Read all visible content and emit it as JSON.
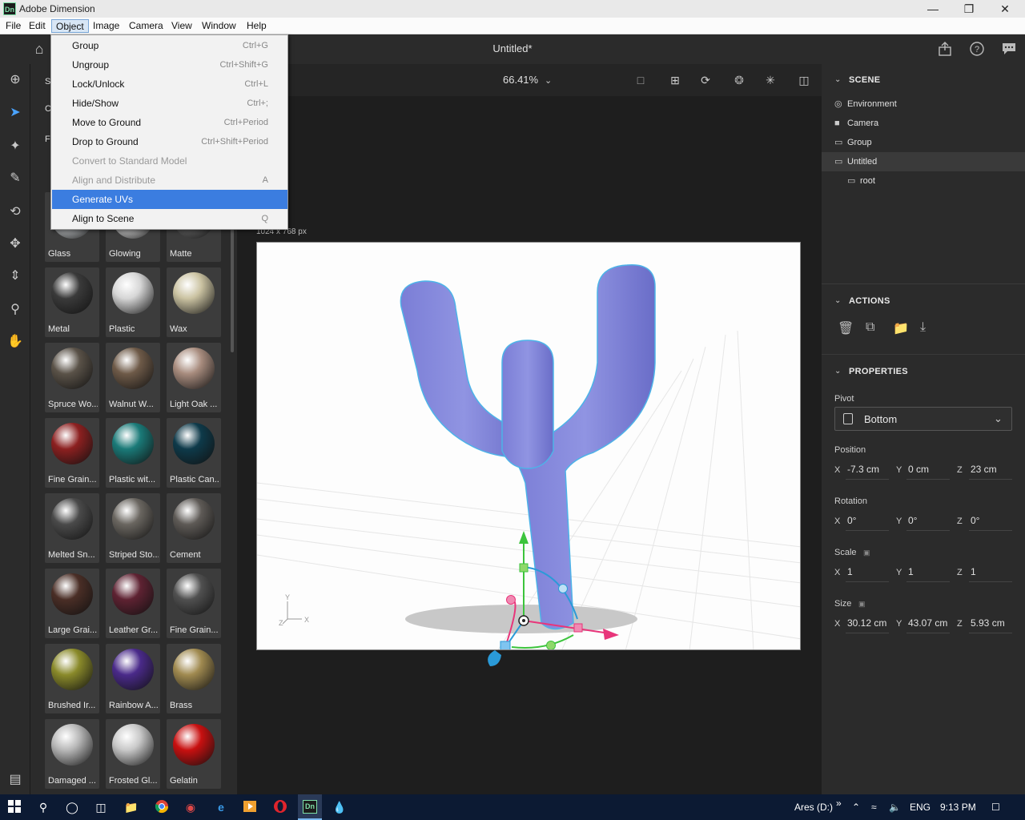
{
  "window": {
    "title": "Adobe Dimension",
    "logo": "Dn",
    "minimize_icon": "minimize-icon",
    "maximize_icon": "restore-icon",
    "close_icon": "close-icon"
  },
  "menubar": [
    "File",
    "Edit",
    "Object",
    "Image",
    "Camera",
    "View",
    "Window",
    "Help"
  ],
  "header": {
    "doc_title": "Untitled*"
  },
  "object_menu": [
    {
      "label": "Group",
      "shortcut": "Ctrl+G",
      "state": "normal"
    },
    {
      "label": "Ungroup",
      "shortcut": "Ctrl+Shift+G",
      "state": "normal"
    },
    {
      "label": "Lock/Unlock",
      "shortcut": "Ctrl+L",
      "state": "normal"
    },
    {
      "label": "Hide/Show",
      "shortcut": "Ctrl+;",
      "state": "normal"
    },
    {
      "label": "Move to Ground",
      "shortcut": "Ctrl+Period",
      "state": "normal"
    },
    {
      "label": "Drop to Ground",
      "shortcut": "Ctrl+Shift+Period",
      "state": "normal"
    },
    {
      "label": "Convert to Standard Model",
      "shortcut": "",
      "state": "disabled"
    },
    {
      "label": "Align and Distribute",
      "shortcut": "A",
      "state": "disabled"
    },
    {
      "label": "Generate UVs",
      "shortcut": "",
      "state": "highlighted"
    },
    {
      "label": "Align to Scene",
      "shortcut": "Q",
      "state": "normal"
    }
  ],
  "canvas": {
    "zoom": "66.41%",
    "size_label": "1024 x 768 px",
    "axis_labels": {
      "y": "Y",
      "x": "X",
      "z": "Z"
    }
  },
  "materials": [
    {
      "label": "Glass",
      "color": "#cfd3d6"
    },
    {
      "label": "Glowing",
      "color": "#e8e8e8"
    },
    {
      "label": "Matte",
      "color": "#6d6d6d"
    },
    {
      "label": "Metal",
      "color": "#3a3a3a"
    },
    {
      "label": "Plastic",
      "color": "#d6d6d6"
    },
    {
      "label": "Wax",
      "color": "#cbc3a2"
    },
    {
      "label": "Spruce Wo...",
      "color": "#5a5248"
    },
    {
      "label": "Walnut W...",
      "color": "#6e5a48"
    },
    {
      "label": "Light Oak ...",
      "color": "#a88c7e"
    },
    {
      "label": "Fine Grain...",
      "color": "#8c2020"
    },
    {
      "label": "Plastic wit...",
      "color": "#1a7a78"
    },
    {
      "label": "Plastic Can...",
      "color": "#0e3a4a"
    },
    {
      "label": "Melted Sn...",
      "color": "#4a4a4a"
    },
    {
      "label": "Striped Sto...",
      "color": "#6a6660"
    },
    {
      "label": "Cement",
      "color": "#5e5a56"
    },
    {
      "label": "Large Grai...",
      "color": "#4a2e26"
    },
    {
      "label": "Leather Gr...",
      "color": "#5e2232"
    },
    {
      "label": "Fine Grain...",
      "color": "#505050"
    },
    {
      "label": "Brushed Ir...",
      "color": "#8a8a2a"
    },
    {
      "label": "Rainbow A...",
      "color": "#4a2a8a"
    },
    {
      "label": "Brass",
      "color": "#a08a50"
    },
    {
      "label": "Damaged ...",
      "color": "#b8b8b8"
    },
    {
      "label": "Frosted Gl...",
      "color": "#c8c8c8"
    },
    {
      "label": "Gelatin",
      "color": "#c81010"
    }
  ],
  "scene": {
    "header": "SCENE",
    "items": [
      {
        "label": "Environment",
        "icon": "globe-icon",
        "indent": false,
        "selected": false
      },
      {
        "label": "Camera",
        "icon": "camera-icon",
        "indent": false,
        "selected": false
      },
      {
        "label": "Group",
        "icon": "folder-icon",
        "indent": false,
        "selected": false
      },
      {
        "label": "Untitled",
        "icon": "folder-icon",
        "indent": false,
        "selected": true
      },
      {
        "label": "root",
        "icon": "folder-icon",
        "indent": true,
        "selected": false
      }
    ]
  },
  "actions": {
    "header": "ACTIONS"
  },
  "properties": {
    "header": "PROPERTIES",
    "pivot_label": "Pivot",
    "pivot_value": "Bottom",
    "position_label": "Position",
    "position": {
      "x": "-7.3 cm",
      "y": "0 cm",
      "z": "23 cm"
    },
    "rotation_label": "Rotation",
    "rotation": {
      "x": "0°",
      "y": "0°",
      "z": "0°"
    },
    "scale_label": "Scale",
    "scale": {
      "x": "1",
      "y": "1",
      "z": "1"
    },
    "size_label": "Size",
    "size": {
      "x": "30.12 cm",
      "y": "43.07 cm",
      "z": "5.93 cm"
    }
  },
  "taskbar": {
    "drive": "Ares (D:)",
    "lang": "ENG",
    "time": "9:13 PM",
    "dn_logo": "Dn"
  },
  "colors": {
    "accent": "#3b7de0",
    "model": "#7f82d8",
    "outline": "#4db3e8"
  }
}
